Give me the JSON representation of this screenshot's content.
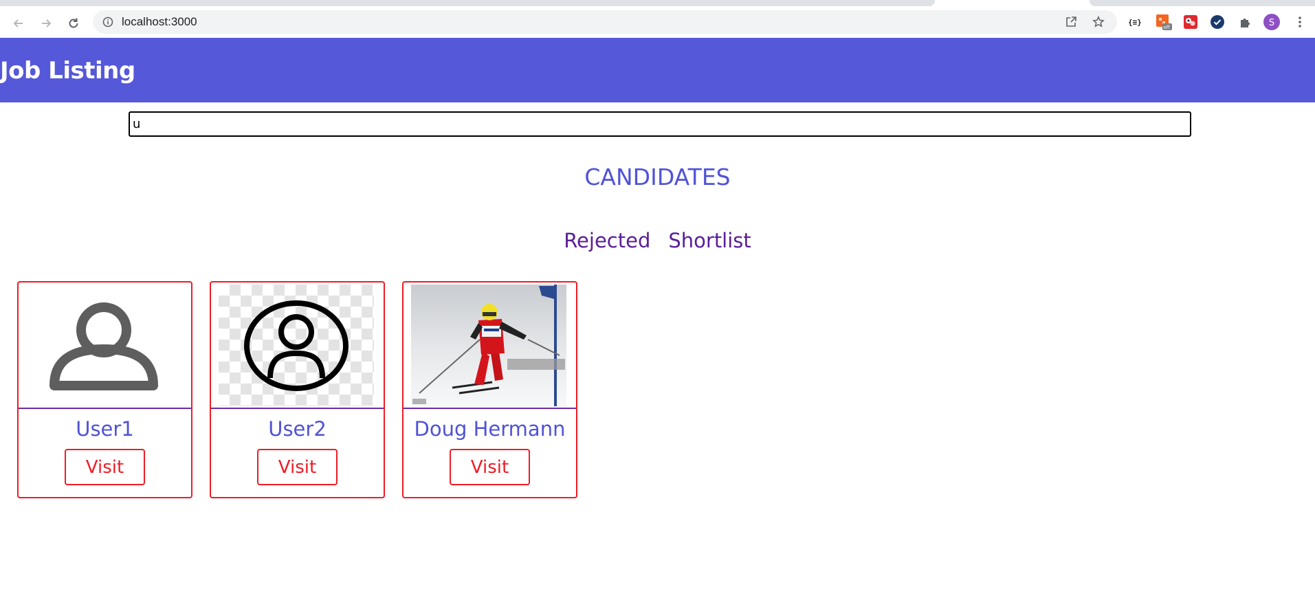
{
  "browser": {
    "url": "localhost:3000",
    "profile_initial": "S",
    "extension_off_badge": "off",
    "icons": [
      "back-arrow-icon",
      "forward-arrow-icon",
      "reload-icon",
      "site-info-icon",
      "share-icon",
      "bookmark-star-icon",
      "json-extension-icon",
      "extension-icon",
      "extensions-puzzle-icon",
      "kebab-menu-icon"
    ]
  },
  "header": {
    "title": "Job Listing"
  },
  "search": {
    "value": "u"
  },
  "section": {
    "title": "CANDIDATES"
  },
  "tabs": [
    {
      "label": "Rejected"
    },
    {
      "label": "Shortlist"
    }
  ],
  "candidates": [
    {
      "name": "User1",
      "action": "Visit",
      "image": "person-outline-icon"
    },
    {
      "name": "User2",
      "action": "Visit",
      "image": "person-circle-icon"
    },
    {
      "name": "Doug Hermann",
      "action": "Visit",
      "image": "skier-photo"
    }
  ],
  "colors": {
    "header_bg": "#5558d8",
    "accent_text": "#5053d6",
    "tab_text": "#5a1d99",
    "card_border": "#ee1c25",
    "divider": "#6a2aa8"
  }
}
